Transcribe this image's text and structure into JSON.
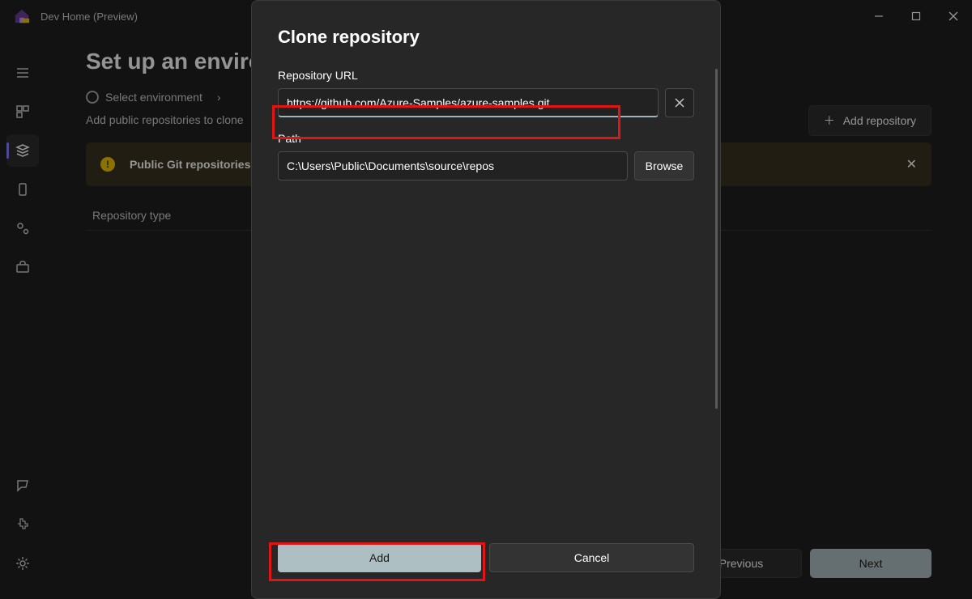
{
  "app": {
    "title": "Dev Home (Preview)"
  },
  "page": {
    "title": "Set up an environment",
    "crumb1": "Select environment",
    "subtext": "Add public repositories to clone",
    "add_repo": "Add repository",
    "banner": "Public Git repositories",
    "table_col1": "Repository type"
  },
  "footer": {
    "prev": "Previous",
    "next": "Next"
  },
  "dialog": {
    "title": "Clone repository",
    "url_label": "Repository URL",
    "url_value": "https://github.com/Azure-Samples/azure-samples.git",
    "path_label": "Path",
    "path_value": "C:\\Users\\Public\\Documents\\source\\repos",
    "browse": "Browse",
    "add": "Add",
    "cancel": "Cancel"
  }
}
